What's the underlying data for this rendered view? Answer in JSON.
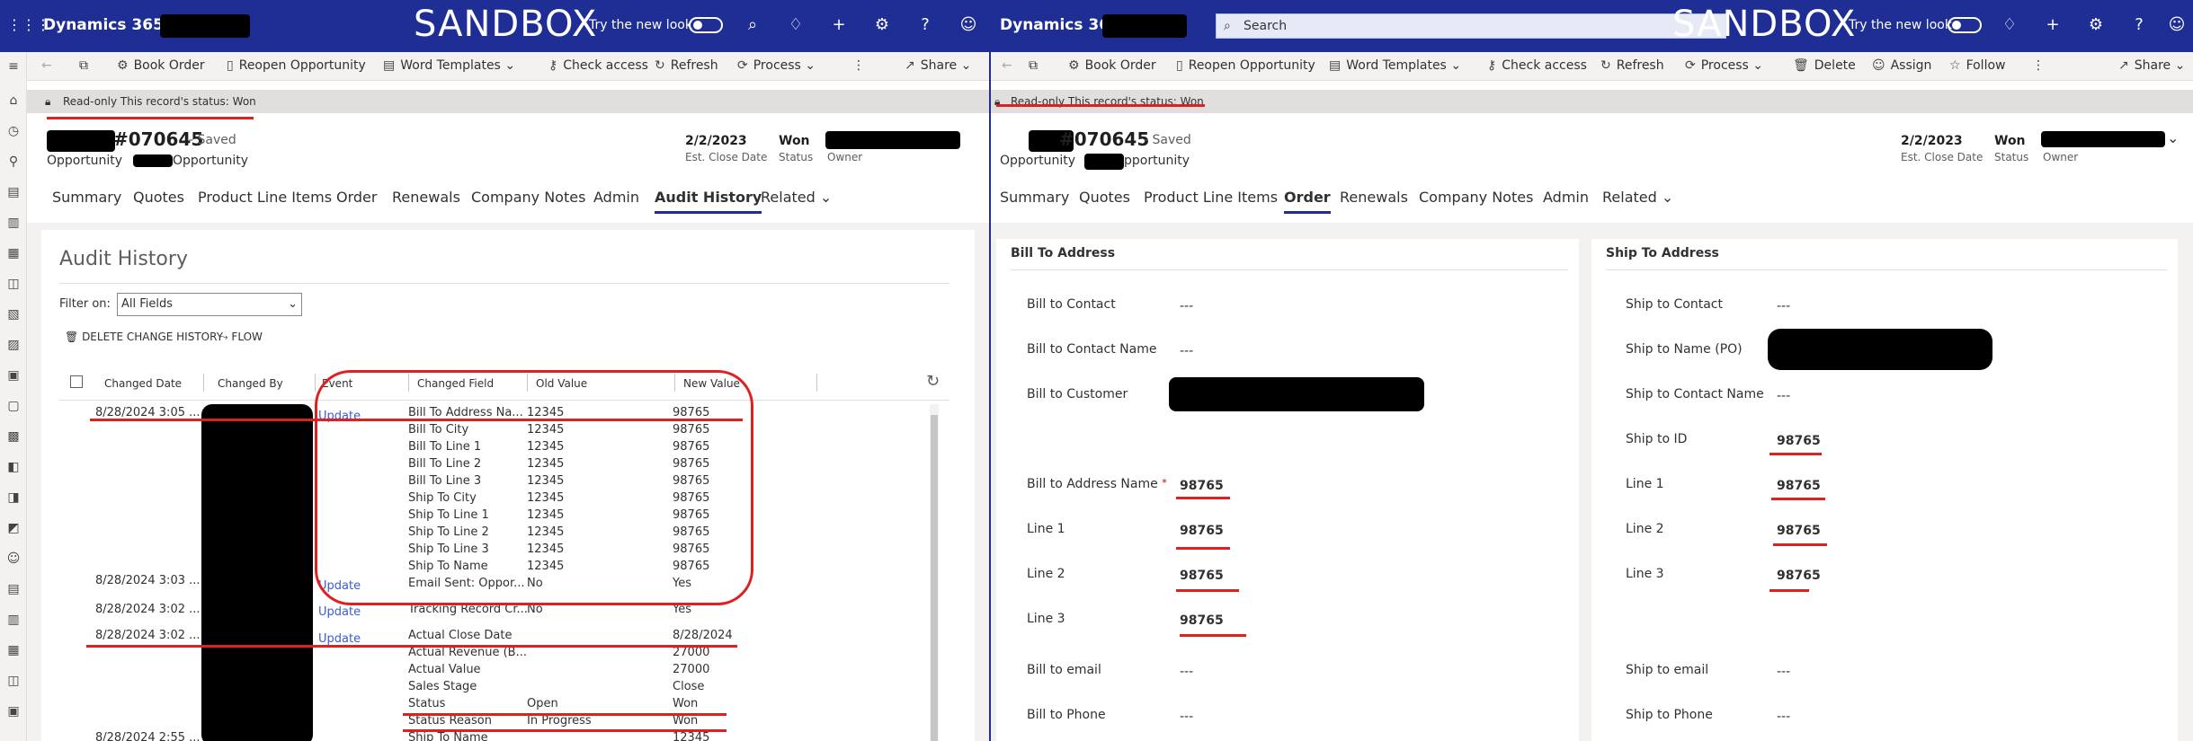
{
  "left": {
    "topbar": {
      "brand": "Dynamics 365",
      "sandbox": "SANDBOX",
      "try_label": "Try the new look"
    },
    "commands": [
      "Book Order",
      "Reopen Opportunity",
      "Word Templates",
      "Check access",
      "Refresh",
      "Process",
      "Share"
    ],
    "readonly_text": "Read-only  This record's status: Won",
    "record": {
      "id_suffix": "#070645",
      "saved": "- Saved",
      "entity": "Opportunity",
      "entity_form": "Opportunity",
      "close_date": "2/2/2023",
      "close_date_label": "Est. Close Date",
      "status": "Won",
      "status_label": "Status",
      "owner_label": "Owner"
    },
    "tabs": [
      "Summary",
      "Quotes",
      "Product Line Items",
      "Order",
      "Renewals",
      "Company Notes",
      "Admin",
      "Audit History",
      "Related"
    ],
    "audit": {
      "title": "Audit History",
      "filter_label": "Filter on:",
      "filter_value": "All Fields",
      "delete_label": "DELETE CHANGE HISTORY",
      "flow_label": "FLOW",
      "columns": [
        "Changed Date",
        "Changed By",
        "Event",
        "Changed Field",
        "Old Value",
        "New Value"
      ],
      "rows": [
        {
          "date": "8/28/2024 3:05 ...",
          "event": "Update",
          "field": "Bill To Address Na...",
          "old": "12345",
          "new": "98765"
        },
        {
          "date": "",
          "event": "",
          "field": "Bill To City",
          "old": "12345",
          "new": "98765"
        },
        {
          "date": "",
          "event": "",
          "field": "Bill To Line 1",
          "old": "12345",
          "new": "98765"
        },
        {
          "date": "",
          "event": "",
          "field": "Bill To Line 2",
          "old": "12345",
          "new": "98765"
        },
        {
          "date": "",
          "event": "",
          "field": "Bill To Line 3",
          "old": "12345",
          "new": "98765"
        },
        {
          "date": "",
          "event": "",
          "field": "Ship To City",
          "old": "12345",
          "new": "98765"
        },
        {
          "date": "",
          "event": "",
          "field": "Ship To Line 1",
          "old": "12345",
          "new": "98765"
        },
        {
          "date": "",
          "event": "",
          "field": "Ship To Line 2",
          "old": "12345",
          "new": "98765"
        },
        {
          "date": "",
          "event": "",
          "field": "Ship To Line 3",
          "old": "12345",
          "new": "98765"
        },
        {
          "date": "",
          "event": "",
          "field": "Ship To Name",
          "old": "12345",
          "new": "98765"
        },
        {
          "date": "8/28/2024 3:03 ...",
          "event": "Update",
          "field": "Email Sent: Oppor...",
          "old": "No",
          "new": "Yes"
        },
        {
          "date": "8/28/2024 3:02 ...",
          "event": "Update",
          "field": "Tracking Record Cr...",
          "old": "No",
          "new": "Yes"
        },
        {
          "date": "8/28/2024 3:02 ...",
          "event": "Update",
          "field": "Actual Close Date",
          "old": "",
          "new": "8/28/2024"
        },
        {
          "date": "",
          "event": "",
          "field": "Actual Revenue (B...",
          "old": "",
          "new": "27000"
        },
        {
          "date": "",
          "event": "",
          "field": "Actual Value",
          "old": "",
          "new": "27000"
        },
        {
          "date": "",
          "event": "",
          "field": "Sales Stage",
          "old": "",
          "new": "Close"
        },
        {
          "date": "",
          "event": "",
          "field": "Status",
          "old": "Open",
          "new": "Won"
        },
        {
          "date": "",
          "event": "",
          "field": "Status Reason",
          "old": "In Progress",
          "new": "Won"
        },
        {
          "date": "8/28/2024 2:55 ...",
          "event": "",
          "field": "Ship To Name",
          "old": "",
          "new": "12345"
        }
      ]
    }
  },
  "right": {
    "topbar": {
      "brand": "Dynamics 365",
      "search_placeholder": "Search",
      "sandbox": "SANDBOX",
      "try_label": "Try the new look"
    },
    "commands": [
      "Book Order",
      "Reopen Opportunity",
      "Word Templates",
      "Check access",
      "Refresh",
      "Process",
      "Delete",
      "Assign",
      "Follow",
      "Share"
    ],
    "readonly_text": "Read-only  This record's status: Won",
    "record": {
      "id_suffix": "#070645",
      "saved": "- Saved",
      "entity": "Opportunity",
      "entity_form": "pportunity",
      "close_date": "2/2/2023",
      "close_date_label": "Est. Close Date",
      "status": "Won",
      "status_label": "Status",
      "owner_label": "Owner"
    },
    "tabs": [
      "Summary",
      "Quotes",
      "Product Line Items",
      "Order",
      "Renewals",
      "Company Notes",
      "Admin",
      "Related"
    ],
    "bill": {
      "title": "Bill To Address",
      "fields": [
        {
          "label": "Bill to Contact",
          "value": "---"
        },
        {
          "label": "Bill to Contact Name",
          "value": "---"
        },
        {
          "label": "Bill to Customer",
          "value": ""
        },
        {
          "label": "Bill to Address Name",
          "value": "98765",
          "required": "*"
        },
        {
          "label": "Line 1",
          "value": "98765"
        },
        {
          "label": "Line 2",
          "value": "98765"
        },
        {
          "label": "Line 3",
          "value": "98765"
        },
        {
          "label": "Bill to email",
          "value": "---"
        },
        {
          "label": "Bill to Phone",
          "value": "---"
        }
      ]
    },
    "ship": {
      "title": "Ship To Address",
      "fields": [
        {
          "label": "Ship to Contact",
          "value": "---"
        },
        {
          "label": "Ship to Name (PO)",
          "value": ""
        },
        {
          "label": "Ship to Contact Name",
          "value": "---"
        },
        {
          "label": "Ship to ID",
          "value": "98765"
        },
        {
          "label": "Line 1",
          "value": "98765"
        },
        {
          "label": "Line 2",
          "value": "98765"
        },
        {
          "label": "Line 3",
          "value": "98765"
        },
        {
          "label": "Ship to email",
          "value": "---"
        },
        {
          "label": "Ship to Phone",
          "value": "---"
        }
      ]
    }
  },
  "colors": {
    "topbar": "#1e2e94",
    "annotation": "#e02020",
    "accent": "#1e2e94"
  }
}
